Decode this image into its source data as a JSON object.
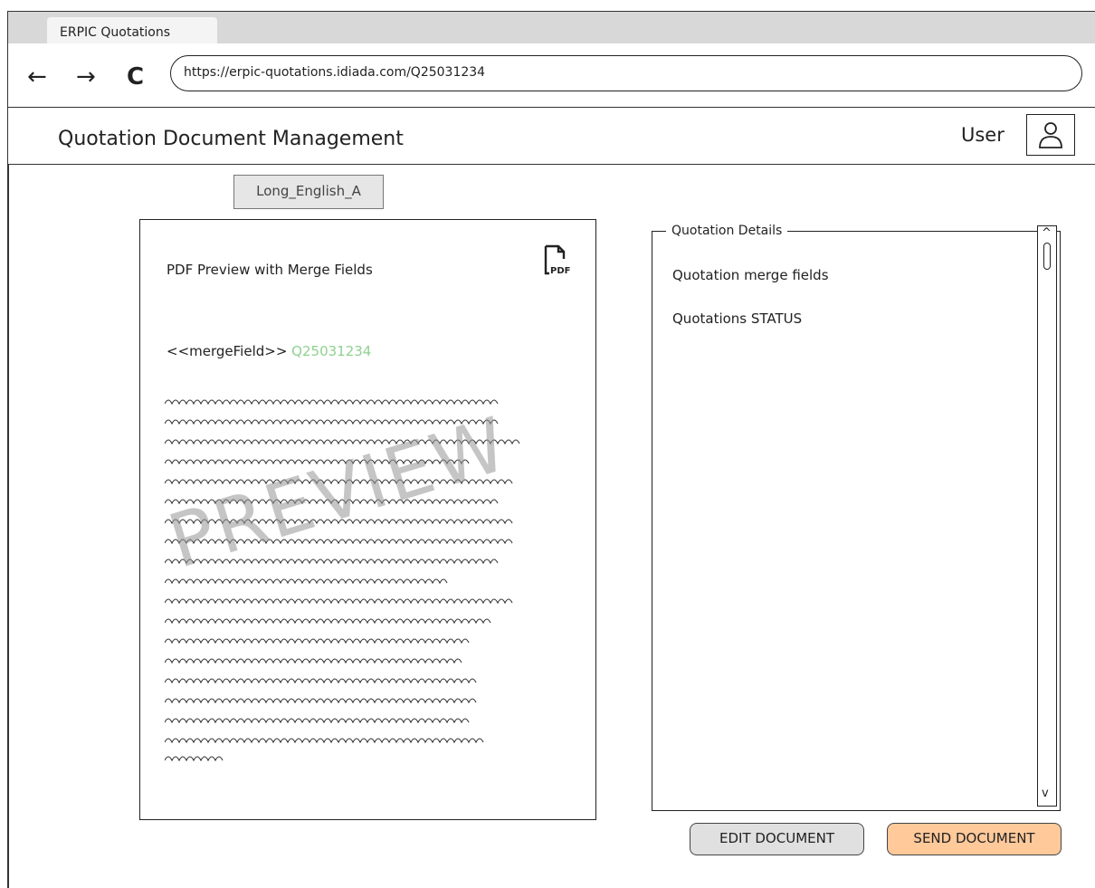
{
  "browser": {
    "tab_title": "ERPIC Quotations",
    "back_glyph": "←",
    "forward_glyph": "→",
    "reload_glyph": "C",
    "url": "https://erpic-quotations.idiada.com/Q25031234"
  },
  "header": {
    "title": "Quotation Document Management",
    "user_label": "User",
    "avatar_icon": "user-icon"
  },
  "template_selector": {
    "label": "Long_English_A"
  },
  "preview": {
    "title": "PDF Preview with Merge Fields",
    "pdf_icon_label": "PDF",
    "merge_field_label": "<<mergeField>>",
    "merge_field_value": "Q25031234",
    "watermark": "PREVIEW",
    "merge_value_color": "#8fd18f"
  },
  "details": {
    "legend": "Quotation Details",
    "lines": [
      "Quotation merge fields",
      "Quotations STATUS"
    ],
    "scroll_up_glyph": "^",
    "scroll_down_glyph": "v"
  },
  "actions": {
    "edit_label": "EDIT DOCUMENT",
    "send_label": "SEND DOCUMENT",
    "send_color": "#ffc99a"
  }
}
